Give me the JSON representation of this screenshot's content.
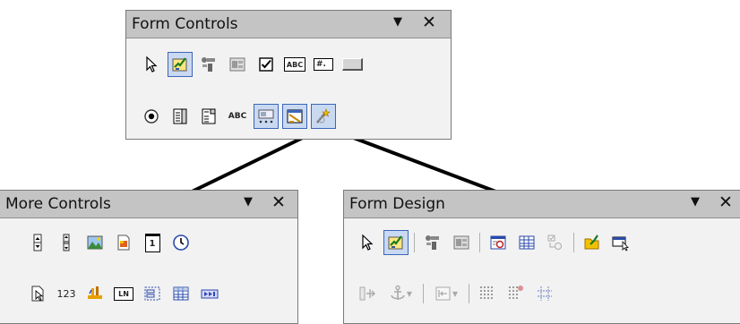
{
  "form_controls": {
    "title": "Form Controls",
    "menu_glyph": "▼",
    "close_glyph": "✕",
    "row1": [
      "select-arrow-icon",
      "design-mode-icon",
      "control-wizards-icon",
      "form-navigator-icon",
      "checkbox-icon",
      "text-box-icon",
      "formatted-field-icon",
      "push-button-icon"
    ],
    "row2": [
      "option-button-icon",
      "list-box-icon",
      "combo-box-icon",
      "label-field-icon",
      "more-controls-icon",
      "form-design-icon",
      "wizards-on-off-icon"
    ],
    "label_text": "ABC",
    "textbox_text": "ABC",
    "formatted_text": "#."
  },
  "more_controls": {
    "title": "More Controls",
    "menu_glyph": "▼",
    "close_glyph": "✕",
    "row1": [
      "spin-button-icon",
      "scroll-bar-icon",
      "image-button-icon",
      "image-control-icon",
      "date-field-icon",
      "time-field-icon"
    ],
    "row2": [
      "file-selection-icon",
      "numerical-field-icon",
      "currency-field-icon",
      "pattern-field-icon",
      "group-box-icon",
      "table-control-icon",
      "navigation-bar-icon"
    ],
    "numerical_text": "123",
    "pattern_text": "LN",
    "date_text": "1"
  },
  "form_design": {
    "title": "Form Design",
    "menu_glyph": "▼",
    "close_glyph": "✕"
  },
  "colors": {
    "title_bar": "#c4c4c4",
    "panel": "#f2f2f2",
    "selected_fill": "#c9d9f2",
    "selected_border": "#3d66b8",
    "connector": "#000000"
  }
}
